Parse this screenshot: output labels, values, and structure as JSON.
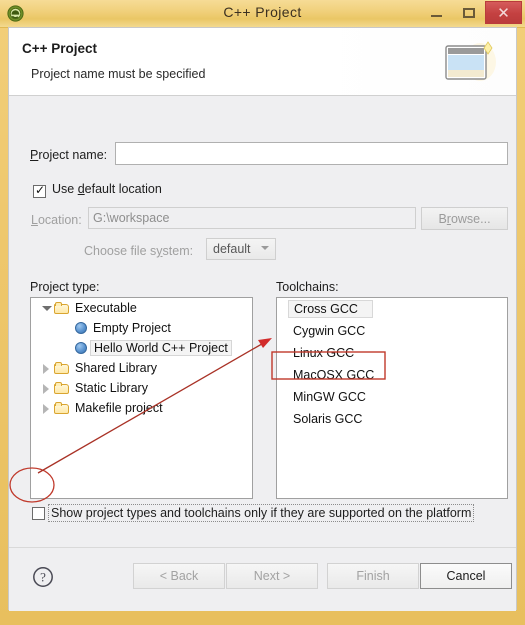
{
  "window": {
    "title": "C++ Project",
    "app_icon": "eclipse-icon",
    "controls": {
      "minimize": "minimize-icon",
      "maximize": "maximize-icon",
      "close": "close-icon"
    },
    "frame_color": "#eac765",
    "close_color": "#c44141"
  },
  "header": {
    "title": "C++ Project",
    "subtitle": "Project name must be specified",
    "icon": "cpp-project-wizard-icon"
  },
  "form": {
    "project_name_label": "Project name:",
    "project_name_value": "",
    "project_name_placeholder": "",
    "use_default_location_label": "Use default location",
    "use_default_location_checked": true,
    "location_label": "Location:",
    "location_value": "G:\\workspace",
    "browse_label": "Browse...",
    "filesystem_label": "Choose file system:",
    "filesystem_value": "default",
    "filesystem_options": [
      "default"
    ]
  },
  "project_type": {
    "label": "Project type:",
    "items": [
      {
        "label": "Executable",
        "depth": 0,
        "icon": "folder-icon",
        "twisty": "open",
        "selected": false
      },
      {
        "label": "Empty Project",
        "depth": 1,
        "icon": "dot-icon",
        "twisty": "none",
        "selected": false
      },
      {
        "label": "Hello World C++ Project",
        "depth": 1,
        "icon": "dot-icon",
        "twisty": "none",
        "selected": true
      },
      {
        "label": "Shared Library",
        "depth": 0,
        "icon": "folder-icon",
        "twisty": "closed",
        "selected": false
      },
      {
        "label": "Static Library",
        "depth": 0,
        "icon": "folder-icon",
        "twisty": "closed",
        "selected": false
      },
      {
        "label": "Makefile project",
        "depth": 0,
        "icon": "folder-icon",
        "twisty": "closed",
        "selected": false
      }
    ]
  },
  "toolchains": {
    "label": "Toolchains:",
    "items": [
      {
        "label": "Cross GCC",
        "selected": true,
        "highlighted": false
      },
      {
        "label": "Cygwin GCC",
        "selected": false,
        "highlighted": false
      },
      {
        "label": "Linux GCC",
        "selected": false,
        "highlighted": false
      },
      {
        "label": "MacOSX GCC",
        "selected": false,
        "highlighted": false
      },
      {
        "label": "MinGW GCC",
        "selected": false,
        "highlighted": true
      },
      {
        "label": "Solaris GCC",
        "selected": false,
        "highlighted": false
      }
    ]
  },
  "options": {
    "show_supported_label": "Show project types and toolchains only if they are supported on the platform",
    "show_supported_checked": false
  },
  "buttons": {
    "help": "help-icon",
    "back": "< Back",
    "next": "Next >",
    "finish": "Finish",
    "cancel": "Cancel"
  },
  "annotation": {
    "color": "#c0392b",
    "shapes": [
      "ellipse-around-show-supported-checkbox",
      "arrow-to-mingw-gcc",
      "rectangle-around-mingw-gcc"
    ]
  }
}
